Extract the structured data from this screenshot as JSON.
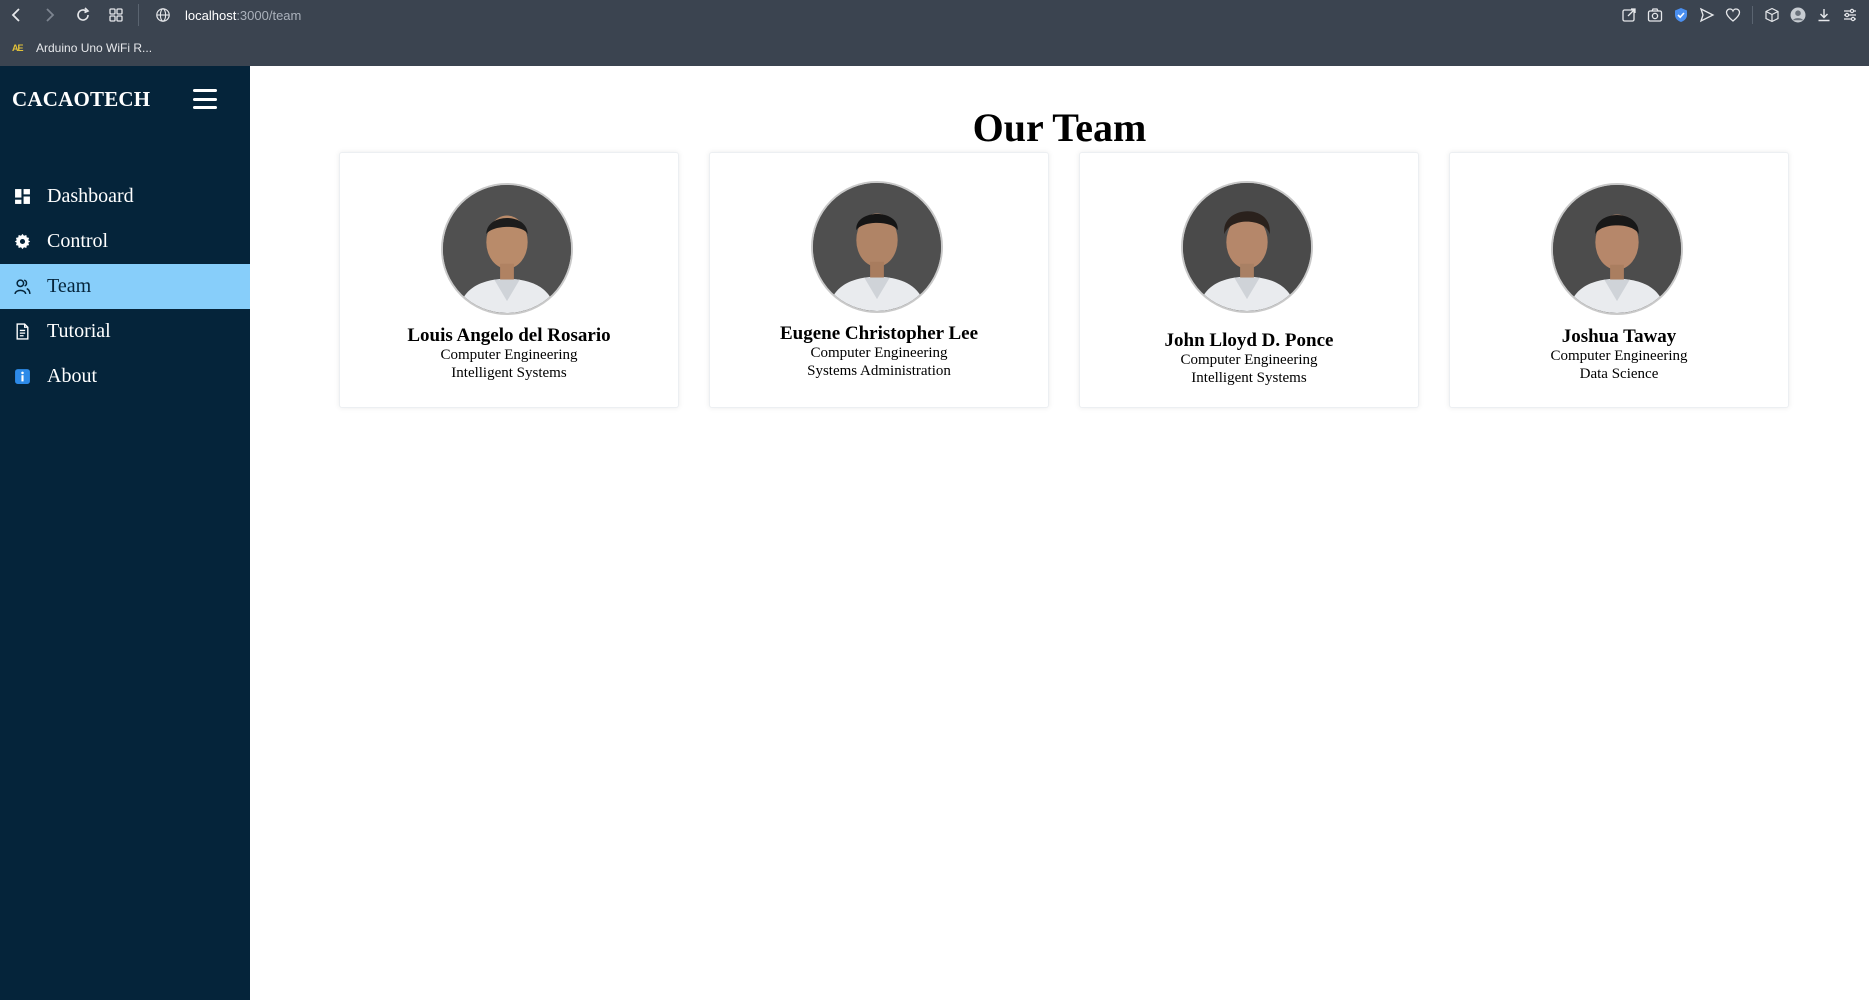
{
  "browser": {
    "url_host": "localhost",
    "url_path": ":3000/team",
    "bookmark_label": "Arduino Uno WiFi R...",
    "bookmark_icon_text": "AE"
  },
  "sidebar": {
    "brand": "CACAOTECH",
    "items": [
      {
        "label": "Dashboard",
        "icon": "dashboard-icon",
        "active": false
      },
      {
        "label": "Control",
        "icon": "gear-icon",
        "active": false
      },
      {
        "label": "Team",
        "icon": "team-icon",
        "active": true
      },
      {
        "label": "Tutorial",
        "icon": "document-icon",
        "active": false
      },
      {
        "label": "About",
        "icon": "info-icon",
        "active": false
      }
    ]
  },
  "main": {
    "title": "Our Team",
    "members": [
      {
        "name": "Louis Angelo del Rosario",
        "program": "Computer Engineering",
        "track": "Intelligent Systems"
      },
      {
        "name": "Eugene Christopher Lee",
        "program": "Computer Engineering",
        "track": "Systems Administration"
      },
      {
        "name": "John Lloyd D. Ponce",
        "program": "Computer Engineering",
        "track": "Intelligent Systems"
      },
      {
        "name": "Joshua Taway",
        "program": "Computer Engineering",
        "track": "Data Science"
      }
    ]
  },
  "colors": {
    "sidebar_bg": "#05243a",
    "active_item_bg": "#87cefa",
    "browser_chrome": "#3b4450"
  }
}
